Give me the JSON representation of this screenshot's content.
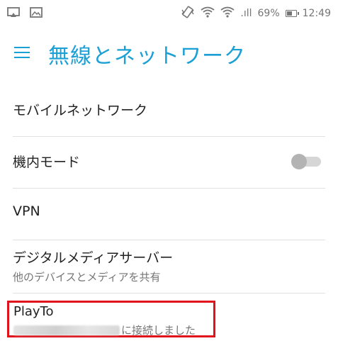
{
  "status_bar": {
    "signal_text": ".ıll",
    "battery_percent": "69%",
    "battery_level": 0.69,
    "time": "12:49",
    "icons": [
      "cast-icon",
      "image-icon",
      "vibrate-icon",
      "wifi-icon",
      "wifi-icon",
      "signal-icon",
      "battery-icon"
    ]
  },
  "header": {
    "title": "無線とネットワーク"
  },
  "items": [
    {
      "title": "モバイルネットワーク"
    },
    {
      "title": "機内モード",
      "toggle_on": false
    },
    {
      "title": "VPN"
    },
    {
      "title": "デジタルメディアサーバー",
      "subtitle": "他のデバイスとメディアを共有"
    },
    {
      "title": "PlayTo",
      "subtitle": "に接続しました"
    }
  ],
  "colors": {
    "accent": "#1ba0d6",
    "highlight_border": "#e0131c"
  }
}
